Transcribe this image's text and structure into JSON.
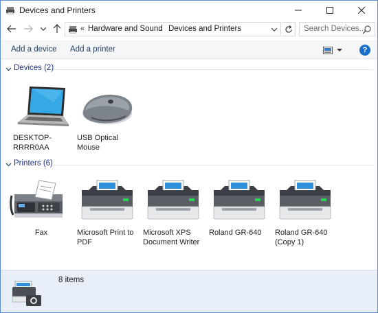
{
  "window": {
    "title": "Devices and Printers",
    "controls": [
      "minimize",
      "maximize",
      "close"
    ]
  },
  "address_bar": {
    "root_separator": "«",
    "crumbs": [
      "Hardware and Sound",
      "Devices and Printers"
    ],
    "separator": "›",
    "search_placeholder": "Search Devices..."
  },
  "toolbar": {
    "add_device": "Add a device",
    "add_printer": "Add a printer"
  },
  "groups": [
    {
      "label": "Devices (2)",
      "items": [
        {
          "name": "DESKTOP-RRRR0AA",
          "icon": "laptop-icon"
        },
        {
          "name": "USB Optical Mouse",
          "icon": "mouse-icon"
        }
      ]
    },
    {
      "label": "Printers (6)",
      "items": [
        {
          "name": "Fax",
          "icon": "fax-icon"
        },
        {
          "name": "Microsoft Print to PDF",
          "icon": "printer-icon"
        },
        {
          "name": "Microsoft XPS Document Writer",
          "icon": "printer-icon"
        },
        {
          "name": "Roland GR-640",
          "icon": "printer-icon"
        },
        {
          "name": "Roland GR-640 (Copy 1)",
          "icon": "printer-icon"
        }
      ]
    }
  ],
  "details": {
    "count": "8 items",
    "icon": "devices-printers-icon"
  },
  "colors": {
    "accent": "#1a6fc9",
    "group_label": "#1e3287",
    "details_bg": "#e8eef7"
  }
}
